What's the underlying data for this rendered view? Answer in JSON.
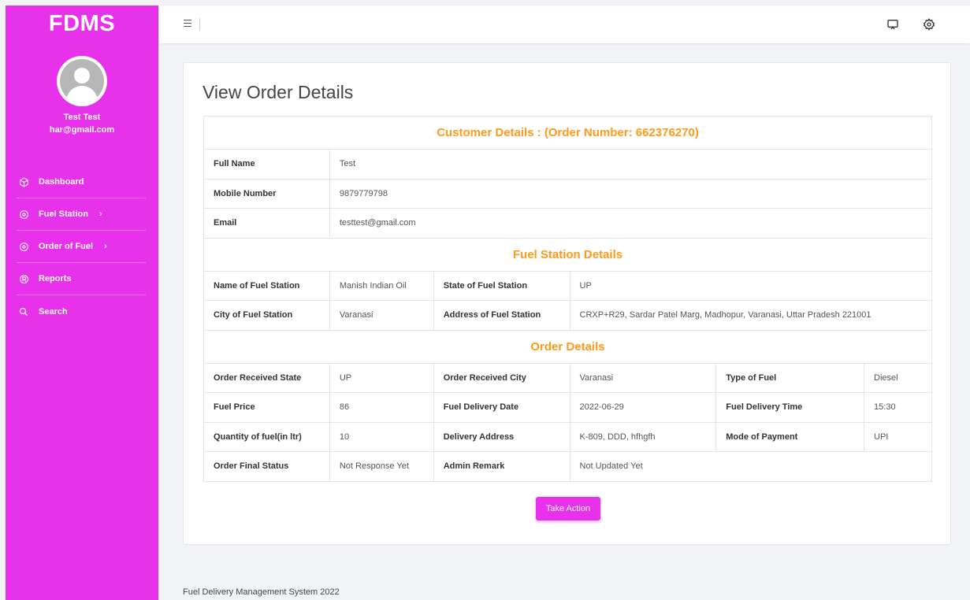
{
  "brand": "FDMS",
  "user": {
    "name": "Test Test",
    "email": "har@gmail.com"
  },
  "nav": [
    {
      "label": "Dashboard",
      "icon": "cube-icon",
      "has_arrow": false
    },
    {
      "label": "Fuel Station",
      "icon": "circle-dot-icon",
      "has_arrow": true,
      "arrow": "›"
    },
    {
      "label": "Order of Fuel",
      "icon": "circle-dot-icon",
      "has_arrow": true,
      "arrow": "›"
    },
    {
      "label": "Reports",
      "icon": "registered-icon",
      "has_arrow": false
    },
    {
      "label": "Search",
      "icon": "search-icon",
      "has_arrow": false
    }
  ],
  "topbar": {
    "icons": [
      "menu-icon",
      "cast-icon",
      "gear-icon"
    ]
  },
  "page": {
    "title": "View Order Details",
    "sections": {
      "customer": "Customer Details : (Order Number: 662376270)",
      "station": "Fuel Station Details",
      "order": "Order Details"
    },
    "customer": {
      "full_name_label": "Full Name",
      "full_name": "Test",
      "mobile_label": "Mobile Number",
      "mobile": "9879779798",
      "email_label": "Email",
      "email": "testtest@gmail.com"
    },
    "station": {
      "name_label": "Name of Fuel Station",
      "name": "Manish Indian Oil",
      "state_label": "State of Fuel Station",
      "state": "UP",
      "city_label": "City of Fuel Station",
      "city": "Varanasi",
      "address_label": "Address of Fuel Station",
      "address": "CRXP+R29, Sardar Patel Marg, Madhopur, Varanasi, Uttar Pradesh 221001"
    },
    "order": {
      "received_state_label": "Order Received State",
      "received_state": "UP",
      "received_city_label": "Order Received City",
      "received_city": "Varanasi",
      "fuel_type_label": "Type of Fuel",
      "fuel_type": "Diesel",
      "price_label": "Fuel Price",
      "price": "86",
      "delivery_date_label": "Fuel Delivery Date",
      "delivery_date": "2022-06-29",
      "delivery_time_label": "Fuel Delivery Time",
      "delivery_time": "15:30",
      "quantity_label": "Quantity of fuel(in ltr)",
      "quantity": "10",
      "delivery_address_label": "Delivery Address",
      "delivery_address": "K-809, DDD, hfhgfh",
      "payment_label": "Mode of Payment",
      "payment": "UPI",
      "final_status_label": "Order Final Status",
      "final_status": "Not Response Yet",
      "admin_remark_label": "Admin Remark",
      "admin_remark": "Not Updated Yet"
    },
    "action_label": "Take Action"
  },
  "footer": "Fuel Delivery Management System 2022",
  "colors": {
    "accent": "#e831ea",
    "section_heading": "#ff9a1a",
    "background": "#f1f3f6"
  }
}
